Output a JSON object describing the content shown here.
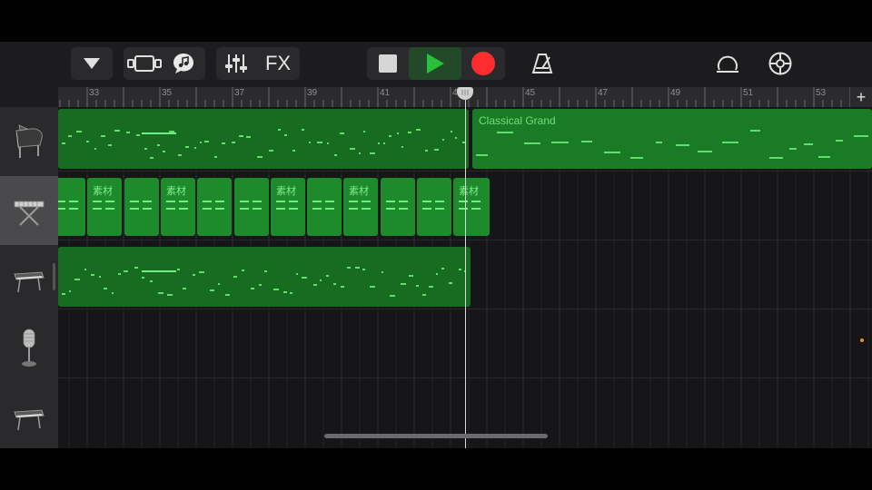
{
  "toolbar": {
    "fx_label": "FX",
    "icons": [
      "browser-toggle-icon",
      "view-toggle-icon",
      "loops-icon",
      "mixer-icon",
      "stop-icon",
      "play-icon",
      "record-icon",
      "metronome-icon",
      "master-effects-icon",
      "settings-icon"
    ],
    "colors": {
      "play": "#27c13b",
      "record": "#ff2d2d",
      "region": "#1a7a26",
      "note": "#5fe06c"
    }
  },
  "ruler": {
    "labels": [
      "33",
      "35",
      "37",
      "39",
      "41",
      "43",
      "45",
      "47",
      "49",
      "51",
      "53"
    ],
    "add_label": "+"
  },
  "tracks": [
    {
      "instrument": "grand-piano-icon",
      "region_name": "Classical Grand"
    },
    {
      "instrument": "keyboard-icon",
      "segment_label": "素材"
    },
    {
      "instrument": "synth-icon"
    },
    {
      "instrument": "microphone-icon"
    },
    {
      "instrument": "synth-icon"
    }
  ]
}
